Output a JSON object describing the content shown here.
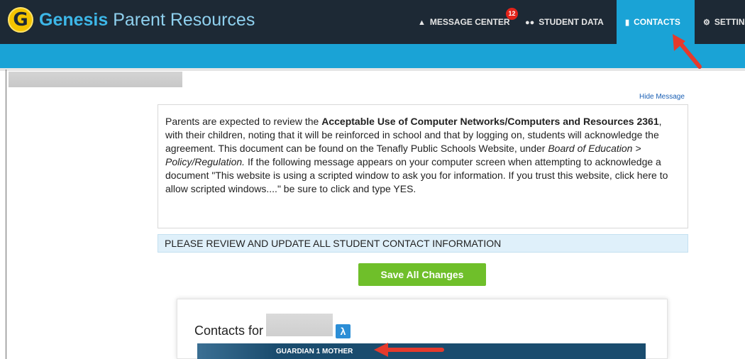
{
  "app": {
    "brand_prefix": "Genesis",
    "brand_suffix": " Parent Resources",
    "logo_letter": "G"
  },
  "nav": {
    "message_center": {
      "label": "MESSAGE CENTER",
      "badge": "12"
    },
    "student_data": {
      "label": "STUDENT DATA"
    },
    "contacts": {
      "label": "CONTACTS"
    },
    "settings": {
      "label": "SETTIN"
    }
  },
  "message": {
    "hide_link": "Hide Message",
    "p1": "Parents are expected to review the ",
    "bold1": "Acceptable Use of Computer Networks/Computers and Resources 2361",
    "p2": ",  with their children, noting that it will be reinforced in school and that by logging on, students will acknowledge the agreement. This document can be found on the Tenafly Public Schools Website, under ",
    "italic1": "Board of Education > Policy/Regulation.",
    "p3": "  If the following message appears on your computer screen when attempting to acknowledge a document \"This website is using a scripted window to ask you for information. If you trust this website, click here to allow scripted windows....\" be sure to click and type YES."
  },
  "banner": {
    "text": "PLEASE REVIEW AND UPDATE ALL STUDENT CONTACT INFORMATION"
  },
  "actions": {
    "save_all": "Save All Changes"
  },
  "contacts": {
    "title": "Contacts for",
    "pdf_icon": "pdf-icon",
    "guardian_label": "GUARDIAN 1  MOTHER"
  },
  "colors": {
    "nav_bg": "#1d2935",
    "accent": "#1aa3d6",
    "save_green": "#6fbf2a",
    "badge_red": "#e2231a",
    "arrow_red": "#e53a2c"
  }
}
